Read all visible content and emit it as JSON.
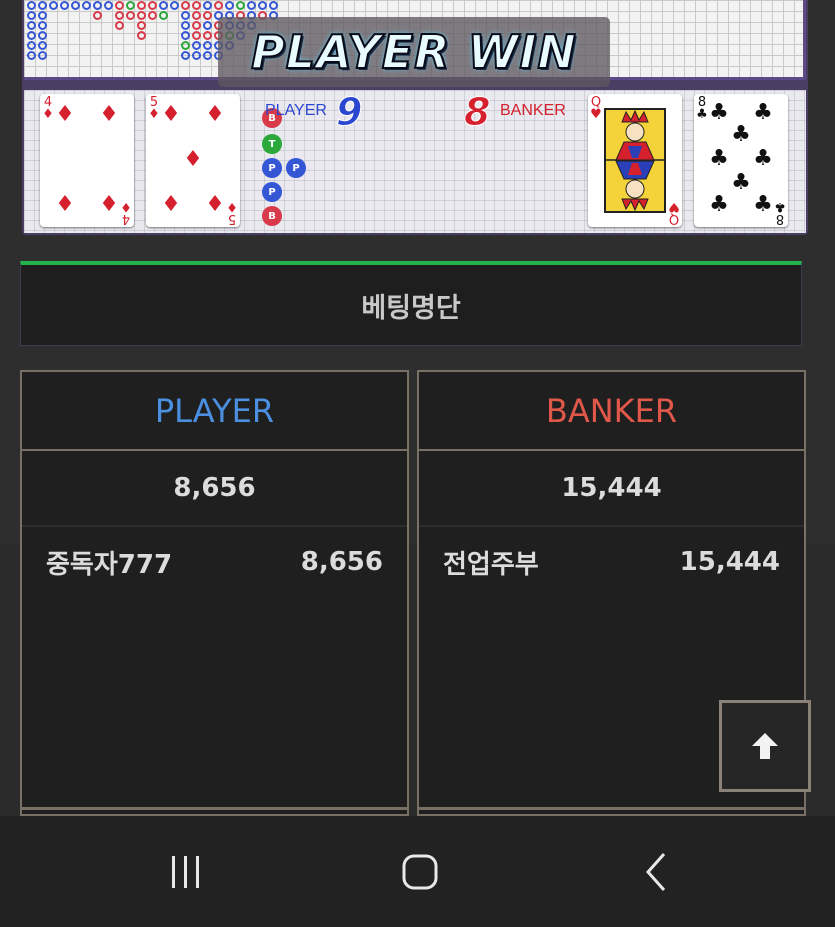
{
  "game": {
    "banner_text": "PLAYER WIN",
    "player_label": "PLAYER",
    "player_score": "9",
    "banker_label": "BANKER",
    "banker_score": "8",
    "player_cards": [
      {
        "rank": "4",
        "suit": "♦",
        "color": "red"
      },
      {
        "rank": "5",
        "suit": "♦",
        "color": "red"
      }
    ],
    "banker_cards": [
      {
        "rank": "Q",
        "suit": "♥",
        "color": "red"
      },
      {
        "rank": "8",
        "suit": "♣",
        "color": "black"
      }
    ],
    "bead_labels": [
      "B",
      "T",
      "P"
    ]
  },
  "betting": {
    "title": "베팅명단",
    "player": {
      "heading": "PLAYER",
      "total": "8,656",
      "rows": [
        {
          "name": "중독자777",
          "amount": "8,656"
        }
      ]
    },
    "banker": {
      "heading": "BANKER",
      "total": "15,444",
      "rows": [
        {
          "name": "전업주부",
          "amount": "15,444"
        }
      ]
    }
  },
  "icons": {
    "scroll_top": "arrow-up-icon",
    "nav_recent": "recent-apps-icon",
    "nav_home": "home-icon",
    "nav_back": "back-icon"
  },
  "colors": {
    "player": "#4a8fe0",
    "banker": "#e0584a",
    "accent": "#22b24c"
  }
}
